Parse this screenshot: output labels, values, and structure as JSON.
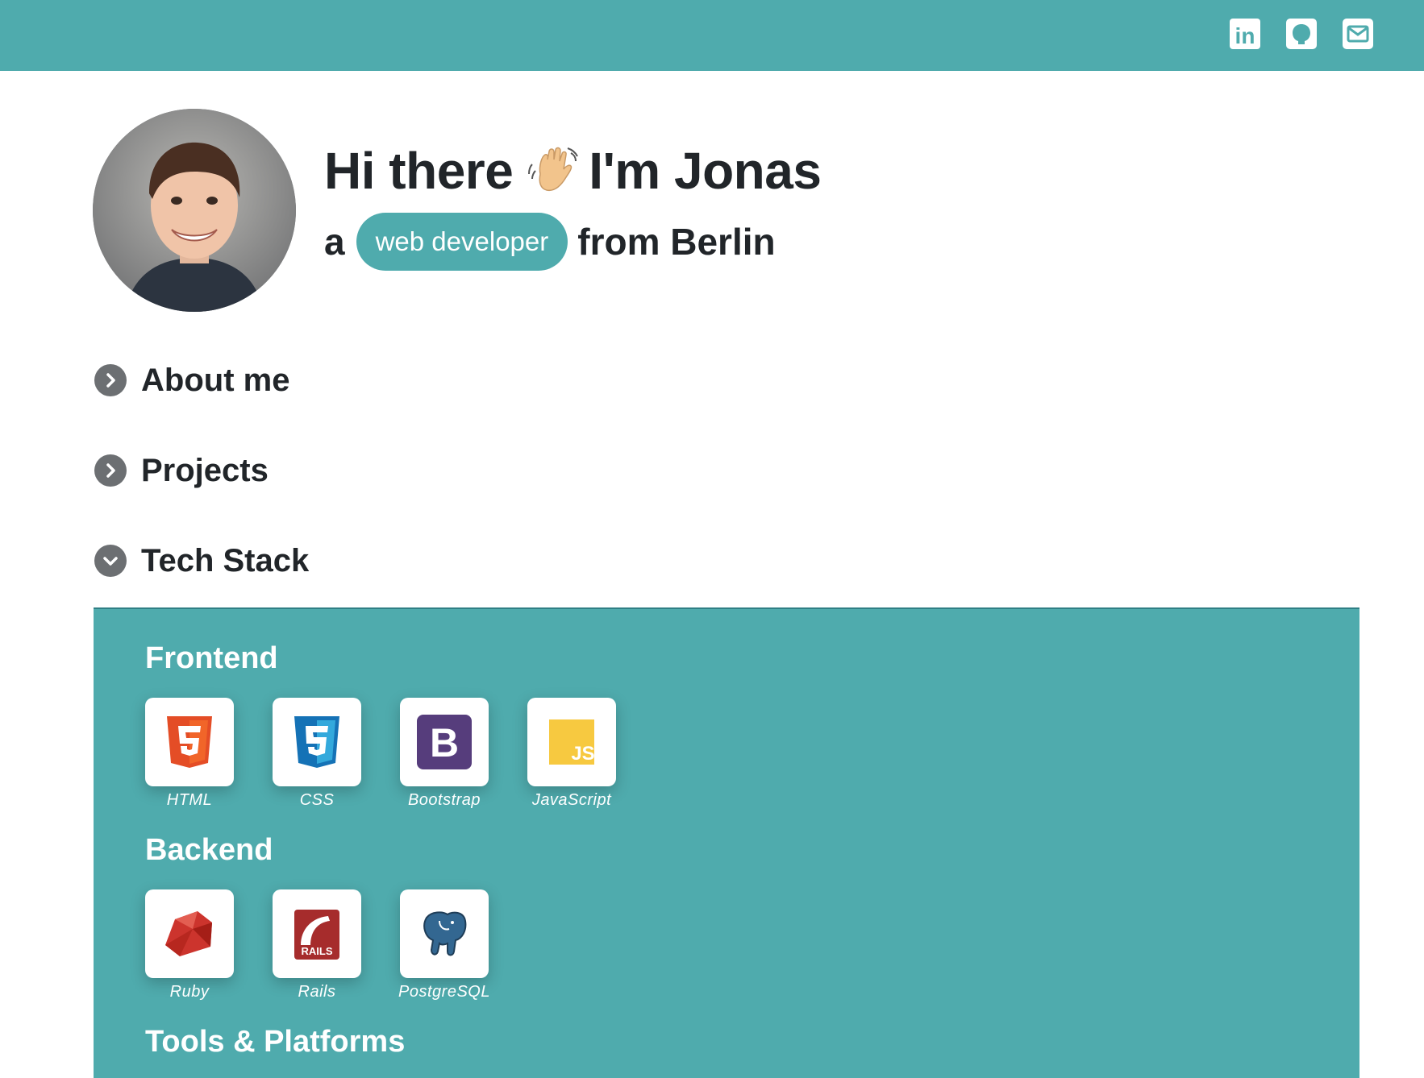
{
  "header": {
    "links": [
      {
        "name": "linkedin-icon",
        "label": "in"
      },
      {
        "name": "github-icon"
      },
      {
        "name": "email-icon"
      }
    ],
    "colors": {
      "bar": "#4fabad",
      "icon": "#ffffff"
    }
  },
  "hero": {
    "greeting": "Hi there",
    "intro": "I'm Jonas",
    "article": "a",
    "role": "web developer",
    "location": "from Berlin"
  },
  "sections": [
    {
      "label": "About me",
      "state": "collapsed"
    },
    {
      "label": "Projects",
      "state": "collapsed"
    },
    {
      "label": "Tech Stack",
      "state": "expanded"
    }
  ],
  "tech_stack": {
    "groups": [
      {
        "title": "Frontend",
        "items": [
          "HTML",
          "CSS",
          "Bootstrap",
          "JavaScript"
        ]
      },
      {
        "title": "Backend",
        "items": [
          "Ruby",
          "Rails",
          "PostgreSQL"
        ]
      },
      {
        "title": "Tools & Platforms",
        "items": []
      }
    ],
    "icons": {
      "bootstrap": "B",
      "javascript": "JS",
      "rails": "RAILS"
    }
  },
  "accent_color": "#4fabad"
}
